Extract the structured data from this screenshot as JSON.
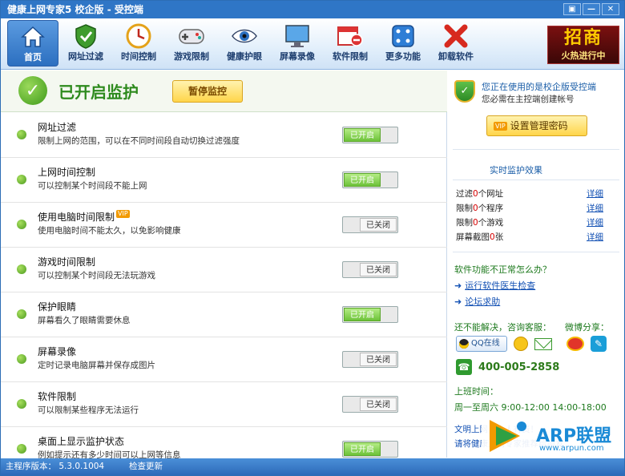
{
  "window": {
    "title": "健康上网专家5 校企版 - 受控端",
    "controls": [
      "▣",
      "—",
      "✕"
    ]
  },
  "toolbar": {
    "items": [
      {
        "label": "首页",
        "icon": "home-icon",
        "active": true
      },
      {
        "label": "网址过滤",
        "icon": "shield-icon"
      },
      {
        "label": "时间控制",
        "icon": "clock-icon"
      },
      {
        "label": "游戏限制",
        "icon": "gamepad-icon"
      },
      {
        "label": "健康护眼",
        "icon": "eye-icon"
      },
      {
        "label": "屏幕录像",
        "icon": "monitor-icon"
      },
      {
        "label": "软件限制",
        "icon": "software-icon"
      },
      {
        "label": "更多功能",
        "icon": "more-icon"
      },
      {
        "label": "卸载软件",
        "icon": "uninstall-icon"
      }
    ],
    "promo": {
      "big": "招商",
      "small": "火热进行中"
    }
  },
  "status_header": {
    "title": "已开启监护",
    "pause_label": "暂停监控"
  },
  "features": [
    {
      "title": "网址过滤",
      "desc": "限制上网的范围，可以在不同时间段自动切换过滤强度",
      "state": "已开启",
      "on": true,
      "vip": false
    },
    {
      "title": "上网时间控制",
      "desc": "可以控制某个时间段不能上网",
      "state": "已开启",
      "on": true,
      "vip": false
    },
    {
      "title": "使用电脑时间限制",
      "desc": "使用电脑时间不能太久，以免影响健康",
      "state": "已关闭",
      "on": false,
      "vip": true
    },
    {
      "title": "游戏时间限制",
      "desc": "可以控制某个时间段无法玩游戏",
      "state": "已关闭",
      "on": false,
      "vip": false
    },
    {
      "title": "保护眼睛",
      "desc": "屏幕看久了眼睛需要休息",
      "state": "已开启",
      "on": true,
      "vip": false
    },
    {
      "title": "屏幕录像",
      "desc": "定时记录电脑屏幕并保存成图片",
      "state": "已关闭",
      "on": false,
      "vip": false
    },
    {
      "title": "软件限制",
      "desc": "可以限制某些程序无法运行",
      "state": "已关闭",
      "on": false,
      "vip": false
    },
    {
      "title": "桌面上显示监护状态",
      "desc": "例如提示还有多少时间可以上网等信息",
      "state": "已开启",
      "on": true,
      "vip": false
    }
  ],
  "vip_badge": "VIP",
  "sidebar": {
    "edition_line": "您正在使用的是校企版受控端",
    "note_line": "您必需在主控端创建帐号",
    "set_password": "设置管理密码",
    "realtime_title": "实时监护效果",
    "stats": [
      {
        "pre": "过滤",
        "num": "0",
        "post": "个网址",
        "link": "详细"
      },
      {
        "pre": "限制",
        "num": "0",
        "post": "个程序",
        "link": "详细"
      },
      {
        "pre": "限制",
        "num": "0",
        "post": "个游戏",
        "link": "详细"
      },
      {
        "pre": "屏幕截图",
        "num": "0",
        "post": "张",
        "link": "详细"
      }
    ],
    "question": "软件功能不正常怎么办？",
    "links": [
      "运行软件医生检查",
      "论坛求助"
    ],
    "contact": "还不能解决，咨询客服：",
    "weibo_share": "微博分享：",
    "qq_online": "QQ在线",
    "phone": "400-005-2858",
    "work_time_label": "上班时间：",
    "work_hours": "周一至周六 9:00-12:00 14:00-18:00",
    "doc_line1": "文明上网，人人有责！",
    "doc_line2": "请将健康上网专家推荐给朋友"
  },
  "watermark": {
    "text": "ARP联盟",
    "url": "www.arpun.com"
  },
  "statusbar": {
    "version": "主程序版本： 5.3.0.1004",
    "check_update": "检查更新"
  }
}
